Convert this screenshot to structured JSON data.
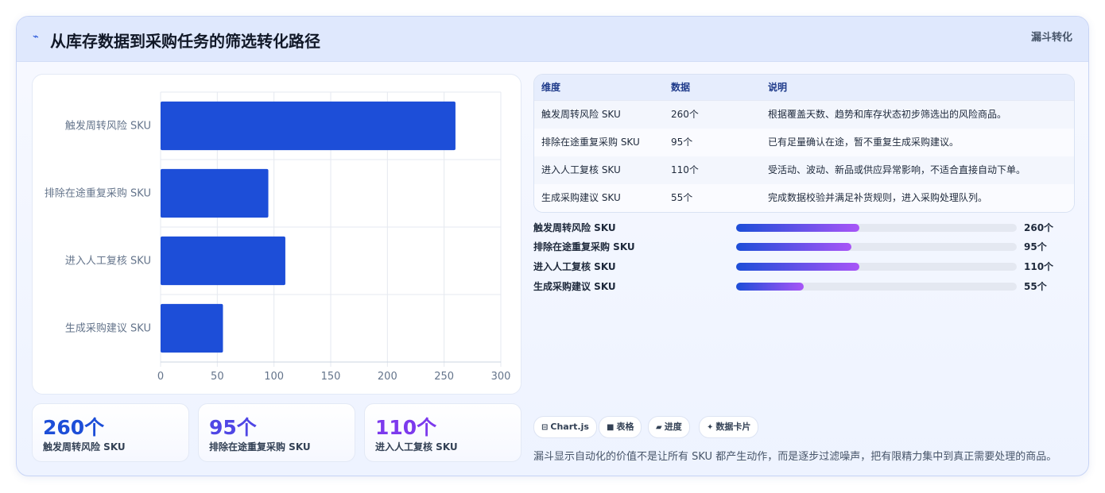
{
  "header": {
    "icon": "spark-icon",
    "title": "从库存数据到采购任务的筛选转化路径",
    "tag": "漏斗转化"
  },
  "chart_data": {
    "type": "bar",
    "orientation": "horizontal",
    "categories": [
      "触发周转风险 SKU",
      "排除在途重复采购 SKU",
      "进入人工复核 SKU",
      "生成采购建议 SKU"
    ],
    "values": [
      260,
      95,
      110,
      55
    ],
    "xlim": [
      0,
      300
    ],
    "xticks": [
      "0",
      "50",
      "100",
      "150",
      "200",
      "250",
      "300"
    ],
    "grid": true,
    "bar_color": "#1d4ed8"
  },
  "stats": [
    {
      "value": "260个",
      "label": "触发周转风险 SKU",
      "color": "#1d4ed8"
    },
    {
      "value": "95个",
      "label": "排除在途重复采购 SKU",
      "color": "#4f46e5"
    },
    {
      "value": "110个",
      "label": "进入人工复核 SKU",
      "color": "#7c3aed"
    }
  ],
  "table": {
    "headers": [
      "维度",
      "数据",
      "说明"
    ],
    "rows": [
      [
        "触发周转风险 SKU",
        "260个",
        "根据覆盖天数、趋势和库存状态初步筛选出的风险商品。"
      ],
      [
        "排除在途重复采购 SKU",
        "95个",
        "已有足量确认在途，暂不重复生成采购建议。"
      ],
      [
        "进入人工复核 SKU",
        "110个",
        "受活动、波动、新品或供应异常影响，不适合直接自动下单。"
      ],
      [
        "生成采购建议 SKU",
        "55个",
        "完成数据校验并满足补货规则，进入采购处理队列。"
      ]
    ]
  },
  "progress": [
    {
      "label": "触发周转风险 SKU",
      "value": "260个",
      "percent": 44
    },
    {
      "label": "排除在途重复采购 SKU",
      "value": "95个",
      "percent": 41
    },
    {
      "label": "进入人工复核 SKU",
      "value": "110个",
      "percent": 44
    },
    {
      "label": "生成采购建议 SKU",
      "value": "55个",
      "percent": 24
    }
  ],
  "chips": [
    {
      "icon": "⊟",
      "label": "Chart.js"
    },
    {
      "icon": "■",
      "label": "表格"
    },
    {
      "icon": "▰",
      "label": "进度"
    },
    {
      "icon": "✦",
      "label": "数据卡片"
    }
  ],
  "footnote": "漏斗显示自动化的价值不是让所有 SKU 都产生动作，而是逐步过滤噪声，把有限精力集中到真正需要处理的商品。"
}
